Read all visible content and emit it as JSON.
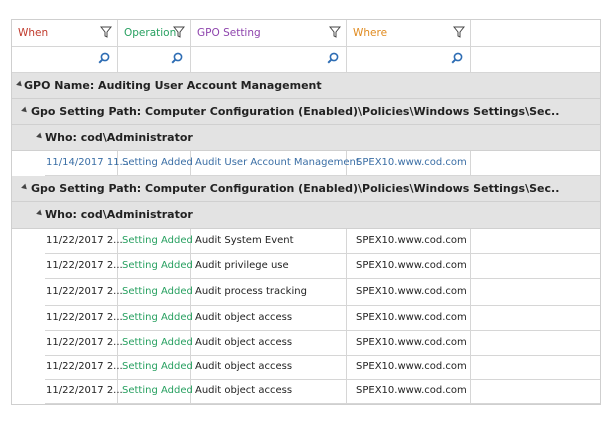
{
  "columns": [
    {
      "label": "When",
      "color": "#c0392b"
    },
    {
      "label": "Operation",
      "color": "#27a060"
    },
    {
      "label": "GPO Setting",
      "color": "#8e44ad"
    },
    {
      "label": "Where",
      "color": "#e08a1e"
    }
  ],
  "group1": "GPO Name: Auditing User Account Management",
  "path1": "Gpo Setting Path: Computer Configuration (Enabled)\\Policies\\Windows Settings\\Sec..",
  "who1": "Who: cod\\Administrator",
  "row1": {
    "when": "11/14/2017 11...",
    "op": "Setting Added",
    "setting": "Audit User Account Management",
    "where": "SPEX10.www.cod.com"
  },
  "path2": "Gpo Setting Path: Computer Configuration (Enabled)\\Policies\\Windows Settings\\Sec..",
  "who2": "Who: cod\\Administrator",
  "rows": [
    {
      "when": "11/22/2017 2...",
      "op": "Setting Added",
      "setting": "Audit System Event",
      "where": "SPEX10.www.cod.com"
    },
    {
      "when": "11/22/2017 2...",
      "op": "Setting Added",
      "setting": "Audit privilege use",
      "where": "SPEX10.www.cod.com"
    },
    {
      "when": "11/22/2017 2...",
      "op": "Setting Added",
      "setting": "Audit process tracking",
      "where": "SPEX10.www.cod.com"
    },
    {
      "when": "11/22/2017 2...",
      "op": "Setting Added",
      "setting": "Audit object access",
      "where": "SPEX10.www.cod.com"
    },
    {
      "when": "11/22/2017 2...",
      "op": "Setting Added",
      "setting": "Audit object access",
      "where": "SPEX10.www.cod.com"
    },
    {
      "when": "11/22/2017 2...",
      "op": "Setting Added",
      "setting": "Audit object access",
      "where": "SPEX10.www.cod.com"
    },
    {
      "when": "11/22/2017 2...",
      "op": "Setting Added",
      "setting": "Audit object access",
      "where": "SPEX10.www.cod.com"
    }
  ],
  "colors": {
    "link": "#3a6ea5",
    "opgreen": "#27a060",
    "band": "#e3e3e3",
    "searchicon": "#2e6db4"
  }
}
